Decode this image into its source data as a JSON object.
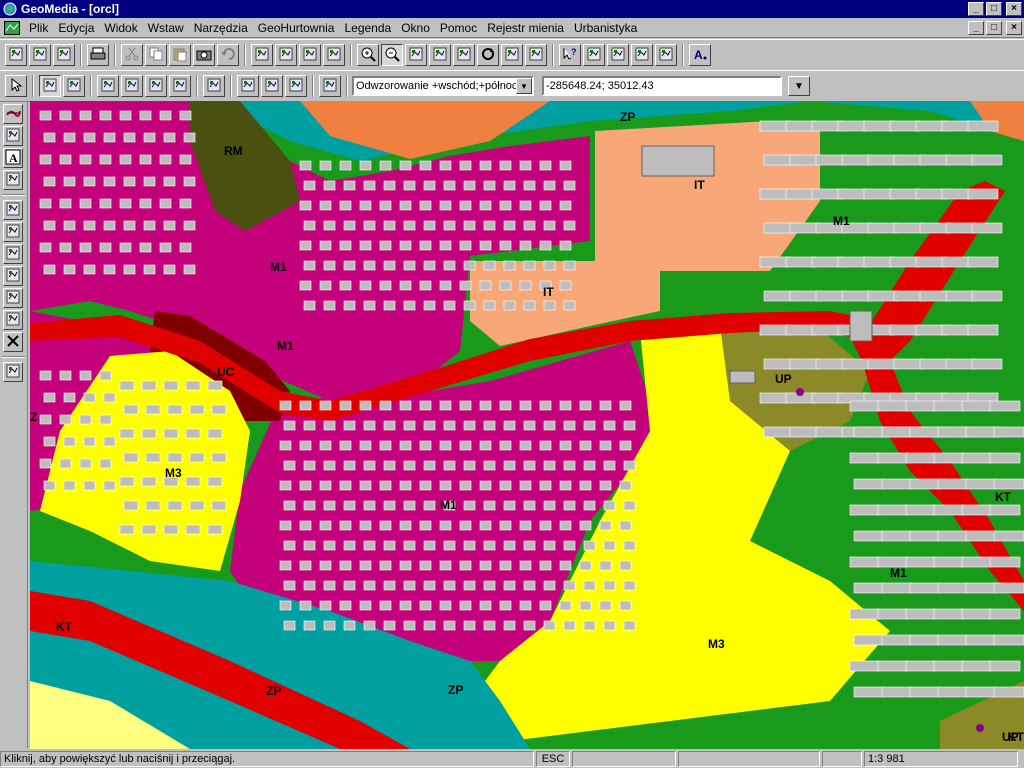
{
  "window": {
    "title": "GeoMedia - [orcl]",
    "minimize_glyph": "_",
    "maximize_glyph": "□",
    "close_glyph": "×"
  },
  "menu": {
    "items": [
      {
        "label": "Plik",
        "accel": "P"
      },
      {
        "label": "Edycja",
        "accel": "E"
      },
      {
        "label": "Widok",
        "accel": "W"
      },
      {
        "label": "Wstaw",
        "accel": "s"
      },
      {
        "label": "Narzędzia",
        "accel": "N"
      },
      {
        "label": "GeoHurtownia",
        "accel": "H"
      },
      {
        "label": "Legenda",
        "accel": "L"
      },
      {
        "label": "Okno",
        "accel": "k"
      },
      {
        "label": "Pomoc",
        "accel": "c"
      },
      {
        "label": "Rejestr mienia",
        "accel": "R"
      },
      {
        "label": "Urbanistyka",
        "accel": "U"
      }
    ]
  },
  "toolbar": {
    "projection_value": "Odwzorowanie +wschód;+północ",
    "coordinates_value": "-285648.24; 35012.43",
    "icons_row1": [
      "new-map-window-icon",
      "new-data-window-icon",
      "layout-icon",
      "print-icon",
      "cut-icon",
      "copy-icon",
      "paste-icon",
      "camera-icon",
      "undo-icon",
      "select-set-icon",
      "properties-icon",
      "query-icon",
      "spatial-query-icon",
      "zoom-in-icon",
      "zoom-out-icon",
      "fit-all-icon",
      "fit-selected-icon",
      "pan-icon",
      "refresh-icon",
      "previous-view-icon",
      "overview-icon",
      "whats-this-icon",
      "data-view-icon",
      "delete-feature-icon",
      "geocode-icon",
      "legend-icon",
      "label-icon"
    ],
    "icons_row2": [
      "select-tool-icon",
      "select-by-area-icon",
      "snap-icon",
      "insert-point-icon",
      "insert-vertex-icon",
      "edit-geometry-icon",
      "attribute-icon",
      "table-icon",
      "grid-icon",
      "sort-up-icon",
      "sort-down-icon",
      "measure-icon"
    ]
  },
  "palette": {
    "icons": [
      "line-tool-icon",
      "text-box-icon",
      "text-tool-icon",
      "hyperlink-icon",
      "rotate-icon",
      "edit-icon",
      "reshape-icon",
      "split-icon",
      "move-icon",
      "spin-icon",
      "cross-icon",
      "catalog-icon"
    ]
  },
  "map": {
    "zone_labels": [
      "RM",
      "IT",
      "IT",
      "M1",
      "M1",
      "M1",
      "M1",
      "M1",
      "KT",
      "KT",
      "KT",
      "UC",
      "UP",
      "UP",
      "M3",
      "M3",
      "ZP",
      "ZP",
      "ZP",
      "Z"
    ],
    "colors": {
      "M1": "#c4007a",
      "M3": "#ffff00",
      "IT": "#f8a878",
      "RM": "#4a5010",
      "UC": "#800000",
      "UP": "#8c8a28",
      "road_KT": "#e00000",
      "green": "#1a9a1a",
      "ZP": "#00a0a0",
      "building": "#bdbdbd"
    }
  },
  "status": {
    "message": "Kliknij, aby powiększyć lub naciśnij i przeciągaj.",
    "esc_label": "ESC",
    "scale": "1:3 981"
  }
}
